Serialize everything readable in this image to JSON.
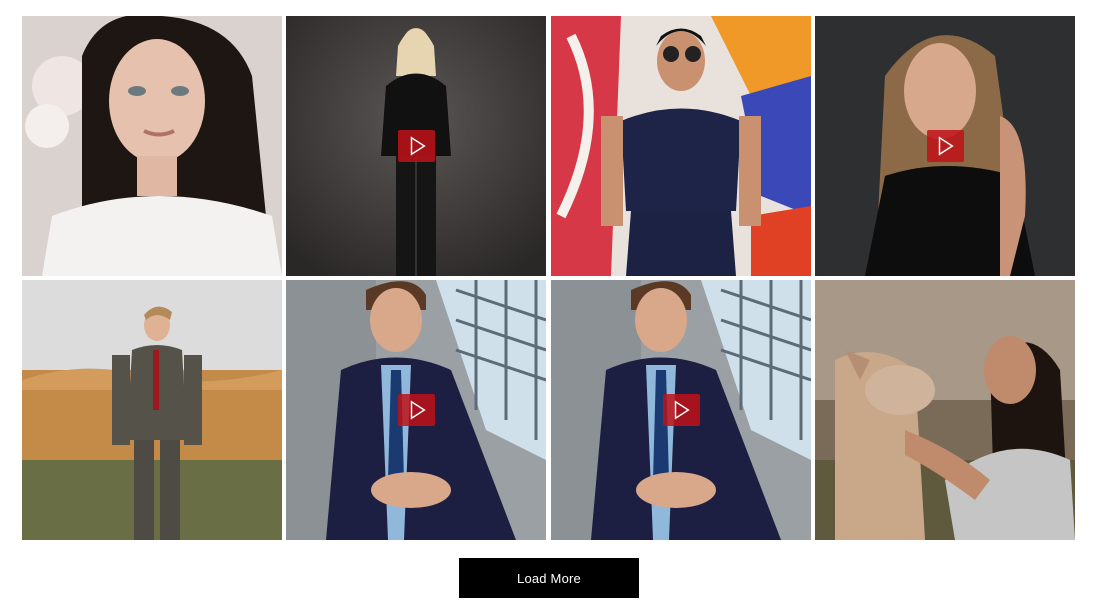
{
  "gallery": {
    "tiles": [
      {
        "has_video": false
      },
      {
        "has_video": true
      },
      {
        "has_video": false
      },
      {
        "has_video": true
      },
      {
        "has_video": false
      },
      {
        "has_video": true
      },
      {
        "has_video": true
      },
      {
        "has_video": false
      }
    ],
    "play_color": "#be1218"
  },
  "load_more": {
    "label": "Load More"
  },
  "colors": {
    "button_bg": "#000000",
    "button_text": "#ffffff",
    "page_bg": "#ffffff"
  }
}
